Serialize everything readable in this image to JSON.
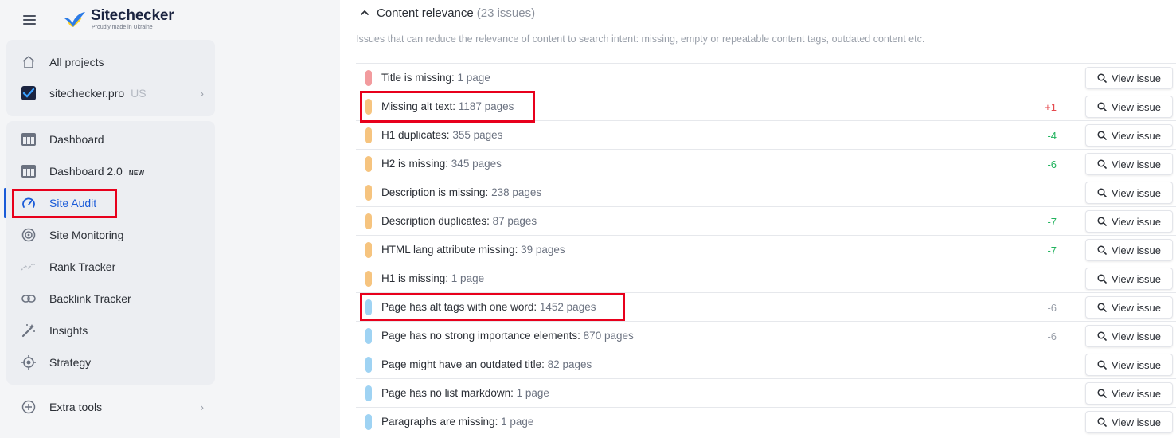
{
  "brand": {
    "name": "Sitechecker",
    "tagline": "Proudly made in Ukraine"
  },
  "sidebar": {
    "top_items": [
      {
        "label": "All projects"
      },
      {
        "label": "sitechecker.pro",
        "country": "US"
      }
    ],
    "items": [
      {
        "label": "Dashboard"
      },
      {
        "label": "Dashboard 2.0",
        "badge": "NEW"
      },
      {
        "label": "Site Audit"
      },
      {
        "label": "Site Monitoring"
      },
      {
        "label": "Rank Tracker"
      },
      {
        "label": "Backlink Tracker"
      },
      {
        "label": "Insights"
      },
      {
        "label": "Strategy"
      }
    ],
    "extra": {
      "label": "Extra tools"
    },
    "active_color": "#1a5bd8"
  },
  "main": {
    "section": {
      "title": "Content relevance",
      "count": "(23 issues)",
      "description": "Issues that can reduce the relevance of content to search intent: missing, empty or repeatable content tags, outdated content etc."
    },
    "view_label": "View issue",
    "rows": [
      {
        "title": "Title is missing:",
        "count": "1 page",
        "severity": "red",
        "delta": ""
      },
      {
        "title": "Missing alt text:",
        "count": "1187 pages",
        "severity": "orange",
        "delta": "+1"
      },
      {
        "title": "H1 duplicates:",
        "count": "355 pages",
        "severity": "orange",
        "delta": "-4"
      },
      {
        "title": "H2 is missing:",
        "count": "345 pages",
        "severity": "orange",
        "delta": "-6"
      },
      {
        "title": "Description is missing:",
        "count": "238 pages",
        "severity": "orange",
        "delta": ""
      },
      {
        "title": "Description duplicates:",
        "count": "87 pages",
        "severity": "orange",
        "delta": "-7"
      },
      {
        "title": "HTML lang attribute missing:",
        "count": "39 pages",
        "severity": "orange",
        "delta": "-7"
      },
      {
        "title": "H1 is missing:",
        "count": "1 page",
        "severity": "orange",
        "delta": ""
      },
      {
        "title": "Page has alt tags with one word:",
        "count": "1452 pages",
        "severity": "blue",
        "delta": "-6"
      },
      {
        "title": "Page has no strong importance elements:",
        "count": "870 pages",
        "severity": "blue",
        "delta": "-6"
      },
      {
        "title": "Page might have an outdated title:",
        "count": "82 pages",
        "severity": "blue",
        "delta": ""
      },
      {
        "title": "Page has no list markdown:",
        "count": "1 page",
        "severity": "blue",
        "delta": ""
      },
      {
        "title": "Paragraphs are missing:",
        "count": "1 page",
        "severity": "blue",
        "delta": ""
      }
    ]
  },
  "colors": {
    "severity_red": "#f29b9e",
    "severity_orange": "#f6c47f",
    "severity_blue": "#9fd3f3",
    "delta_up": "#e5484d",
    "delta_down": "#22b35e",
    "highlight": "#e8001c"
  }
}
